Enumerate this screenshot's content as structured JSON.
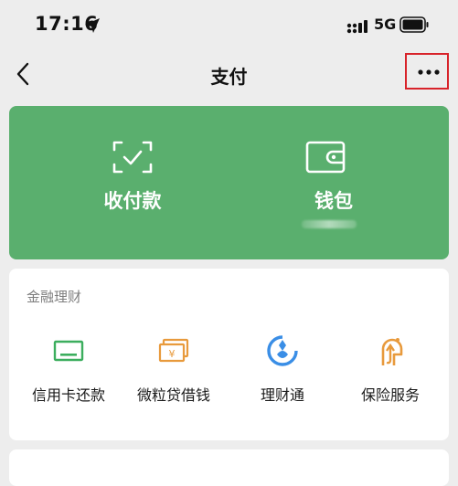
{
  "status_bar": {
    "time": "17:16",
    "network": "5G",
    "icons": [
      "location-arrow-icon",
      "signal-bars-icon",
      "battery-icon"
    ]
  },
  "nav": {
    "title": "支付",
    "back_icon": "chevron-left-icon",
    "more_icon": "ellipsis-icon",
    "highlight_color": "#d8232a"
  },
  "wallet_card": {
    "color": "#5aaf6e",
    "collect_pay": {
      "label": "收付款",
      "icon": "scan-frame-check-icon"
    },
    "wallet": {
      "label": "钱包",
      "icon": "wallet-icon"
    }
  },
  "finance": {
    "section_title": "金融理财",
    "items": [
      {
        "label": "信用卡还款",
        "icon": "credit-card-icon",
        "color": "#3cae5e"
      },
      {
        "label": "微粒贷借钱",
        "icon": "yuan-bill-icon",
        "color": "#e89a3c"
      },
      {
        "label": "理财通",
        "icon": "licaitong-icon",
        "color": "#3a8ee6"
      },
      {
        "label": "保险服务",
        "icon": "insurance-umbrella-icon",
        "color": "#e89a3c"
      }
    ]
  }
}
